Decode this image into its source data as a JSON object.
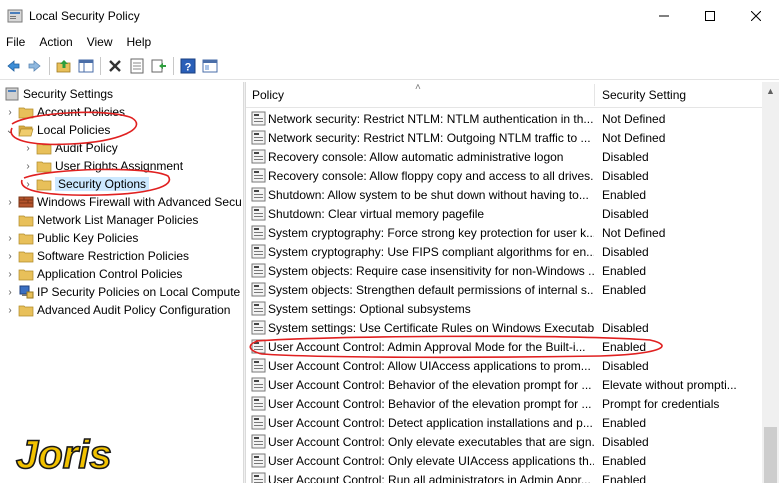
{
  "window": {
    "title": "Local Security Policy",
    "minimize_icon": "minimize-icon",
    "maximize_icon": "maximize-icon",
    "close_icon": "close-icon"
  },
  "menu": [
    "File",
    "Action",
    "View",
    "Help"
  ],
  "toolbar": {
    "icons": [
      "back-arrow-icon",
      "forward-arrow-icon",
      "up-folder-icon",
      "show-hide-tree-icon",
      "delete-icon",
      "properties-icon",
      "export-list-icon",
      "help-icon",
      "console-tree-icon"
    ]
  },
  "tree": {
    "root": "Security Settings",
    "items": [
      {
        "label": "Account Policies"
      },
      {
        "label": "Local Policies"
      },
      {
        "label": "Audit Policy"
      },
      {
        "label": "User Rights Assignment"
      },
      {
        "label": "Security Options"
      },
      {
        "label": "Windows Firewall with Advanced Secu"
      },
      {
        "label": "Network List Manager Policies"
      },
      {
        "label": "Public Key Policies"
      },
      {
        "label": "Software Restriction Policies"
      },
      {
        "label": "Application Control Policies"
      },
      {
        "label": "IP Security Policies on Local Compute"
      },
      {
        "label": "Advanced Audit Policy Configuration"
      }
    ]
  },
  "list": {
    "columns": {
      "policy": "Policy",
      "setting": "Security Setting"
    },
    "rows": [
      {
        "policy": "Network security: Restrict NTLM: NTLM authentication in th...",
        "setting": "Not Defined"
      },
      {
        "policy": "Network security: Restrict NTLM: Outgoing NTLM traffic to ...",
        "setting": "Not Defined"
      },
      {
        "policy": "Recovery console: Allow automatic administrative logon",
        "setting": "Disabled"
      },
      {
        "policy": "Recovery console: Allow floppy copy and access to all drives...",
        "setting": "Disabled"
      },
      {
        "policy": "Shutdown: Allow system to be shut down without having to...",
        "setting": "Enabled"
      },
      {
        "policy": "Shutdown: Clear virtual memory pagefile",
        "setting": "Disabled"
      },
      {
        "policy": "System cryptography: Force strong key protection for user k...",
        "setting": "Not Defined"
      },
      {
        "policy": "System cryptography: Use FIPS compliant algorithms for en...",
        "setting": "Disabled"
      },
      {
        "policy": "System objects: Require case insensitivity for non-Windows ...",
        "setting": "Enabled"
      },
      {
        "policy": "System objects: Strengthen default permissions of internal s...",
        "setting": "Enabled"
      },
      {
        "policy": "System settings: Optional subsystems",
        "setting": ""
      },
      {
        "policy": "System settings: Use Certificate Rules on Windows Executabl...",
        "setting": "Disabled"
      },
      {
        "policy": "User Account Control: Admin Approval Mode for the Built-i...",
        "setting": "Enabled"
      },
      {
        "policy": "User Account Control: Allow UIAccess applications to prom...",
        "setting": "Disabled"
      },
      {
        "policy": "User Account Control: Behavior of the elevation prompt for ...",
        "setting": "Elevate without prompti..."
      },
      {
        "policy": "User Account Control: Behavior of the elevation prompt for ...",
        "setting": "Prompt for credentials"
      },
      {
        "policy": "User Account Control: Detect application installations and p...",
        "setting": "Enabled"
      },
      {
        "policy": "User Account Control: Only elevate executables that are sign...",
        "setting": "Disabled"
      },
      {
        "policy": "User Account Control: Only elevate UIAccess applications th...",
        "setting": "Enabled"
      },
      {
        "policy": "User Account Control: Run all administrators in Admin Appr...",
        "setting": "Enabled"
      }
    ]
  },
  "watermark": {
    "text": "Joris"
  },
  "colors": {
    "annotation": "#e02020",
    "selection": "#cce8ff",
    "folder": "#e8c05a",
    "watermark": "#f2c200"
  }
}
